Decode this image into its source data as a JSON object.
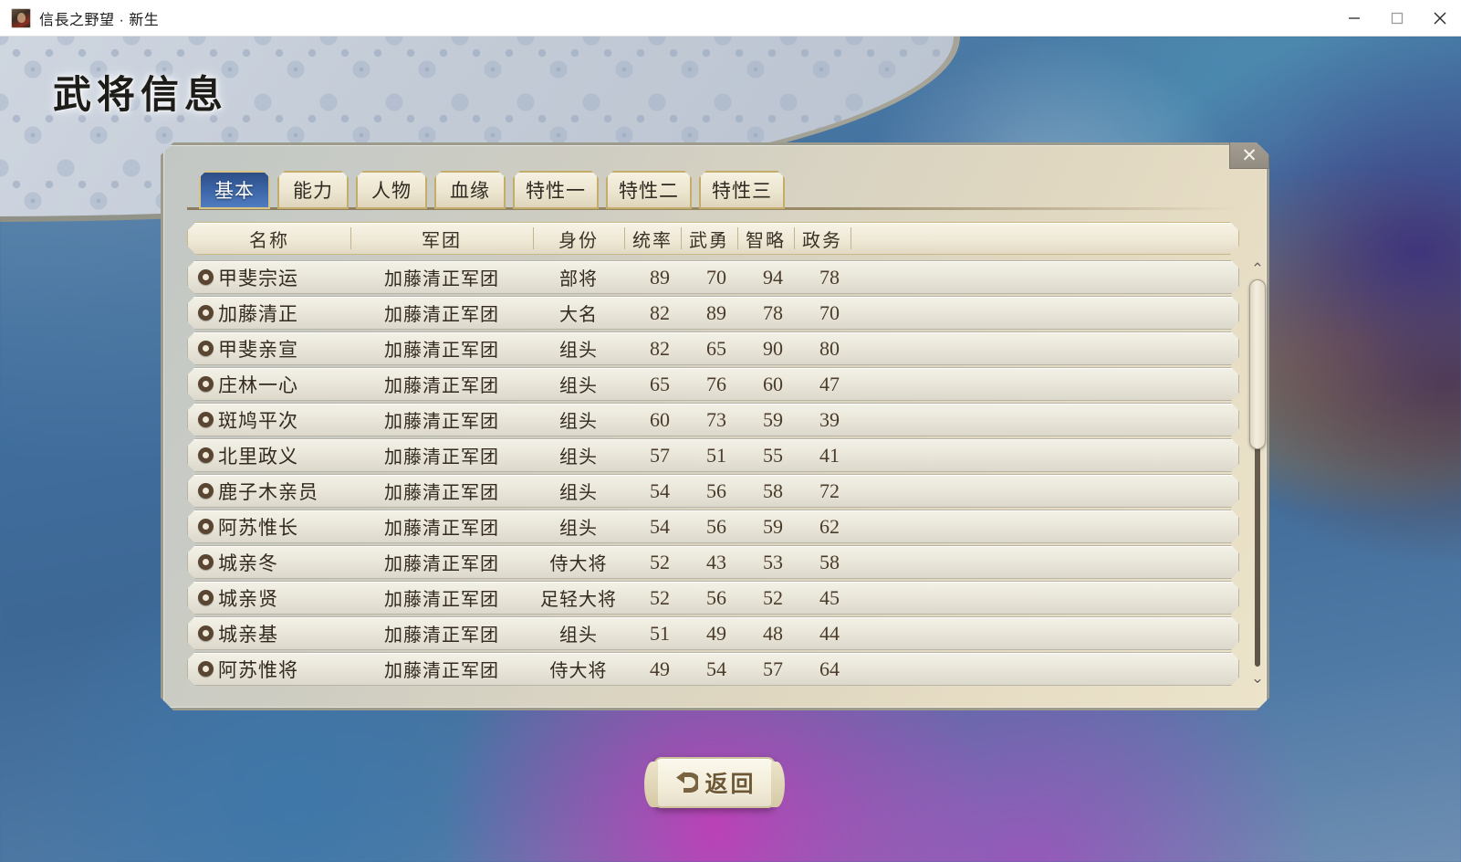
{
  "window": {
    "title": "信長之野望 · 新生",
    "icon": "app-portrait-icon",
    "minimize_label": "—",
    "maximize_label": "□",
    "close_label": "✕"
  },
  "header": {
    "page_title": "武将信息"
  },
  "dialog": {
    "close_label": "✕",
    "tabs": [
      {
        "label": "基本",
        "active": true
      },
      {
        "label": "能力",
        "active": false
      },
      {
        "label": "人物",
        "active": false
      },
      {
        "label": "血缘",
        "active": false
      },
      {
        "label": "特性一",
        "active": false
      },
      {
        "label": "特性二",
        "active": false
      },
      {
        "label": "特性三",
        "active": false
      }
    ],
    "columns": [
      {
        "key": "name",
        "label": "名称",
        "sorted": false
      },
      {
        "key": "corps",
        "label": "军团",
        "sorted": false
      },
      {
        "key": "role",
        "label": "身份",
        "sorted": false
      },
      {
        "key": "tong",
        "label": "统率",
        "sorted": true,
        "sort_icon": "chevron-down-icon"
      },
      {
        "key": "wu",
        "label": "武勇",
        "sorted": false
      },
      {
        "key": "zhi",
        "label": "智略",
        "sorted": false
      },
      {
        "key": "zheng",
        "label": "政务",
        "sorted": false
      }
    ],
    "rows": [
      {
        "name": "甲斐宗运",
        "corps": "加藤清正军团",
        "role": "部将",
        "tong": "89",
        "wu": "70",
        "zhi": "94",
        "zheng": "78"
      },
      {
        "name": "加藤清正",
        "corps": "加藤清正军团",
        "role": "大名",
        "tong": "82",
        "wu": "89",
        "zhi": "78",
        "zheng": "70"
      },
      {
        "name": "甲斐亲宣",
        "corps": "加藤清正军团",
        "role": "组头",
        "tong": "82",
        "wu": "65",
        "zhi": "90",
        "zheng": "80"
      },
      {
        "name": "庄林一心",
        "corps": "加藤清正军团",
        "role": "组头",
        "tong": "65",
        "wu": "76",
        "zhi": "60",
        "zheng": "47"
      },
      {
        "name": "斑鸠平次",
        "corps": "加藤清正军团",
        "role": "组头",
        "tong": "60",
        "wu": "73",
        "zhi": "59",
        "zheng": "39"
      },
      {
        "name": "北里政义",
        "corps": "加藤清正军团",
        "role": "组头",
        "tong": "57",
        "wu": "51",
        "zhi": "55",
        "zheng": "41"
      },
      {
        "name": "鹿子木亲员",
        "corps": "加藤清正军团",
        "role": "组头",
        "tong": "54",
        "wu": "56",
        "zhi": "58",
        "zheng": "72"
      },
      {
        "name": "阿苏惟长",
        "corps": "加藤清正军团",
        "role": "组头",
        "tong": "54",
        "wu": "56",
        "zhi": "59",
        "zheng": "62"
      },
      {
        "name": "城亲冬",
        "corps": "加藤清正军团",
        "role": "侍大将",
        "tong": "52",
        "wu": "43",
        "zhi": "53",
        "zheng": "58"
      },
      {
        "name": "城亲贤",
        "corps": "加藤清正军团",
        "role": "足轻大将",
        "tong": "52",
        "wu": "56",
        "zhi": "52",
        "zheng": "45"
      },
      {
        "name": "城亲基",
        "corps": "加藤清正军团",
        "role": "组头",
        "tong": "51",
        "wu": "49",
        "zhi": "48",
        "zheng": "44"
      },
      {
        "name": "阿苏惟将",
        "corps": "加藤清正军团",
        "role": "侍大将",
        "tong": "49",
        "wu": "54",
        "zhi": "57",
        "zheng": "64"
      }
    ],
    "scrollbar": {
      "up_icon": "chevron-up-icon",
      "down_icon": "chevron-down-icon"
    }
  },
  "footer": {
    "back_label": "返回",
    "back_icon": "back-arrow-icon"
  },
  "colors": {
    "accent_blue": "#3a63a4",
    "panel_gold": "#c4ac6b",
    "text_brown": "#33291f",
    "background_blue": "#3f6b9e"
  }
}
